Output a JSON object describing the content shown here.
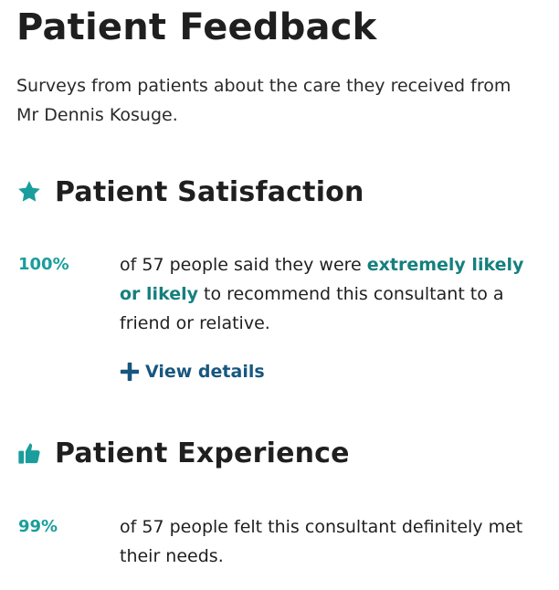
{
  "page": {
    "title": "Patient Feedback",
    "intro": "Surveys from patients about the care they received from Mr Dennis Kosuge."
  },
  "colors": {
    "accent_teal": "#1a9e9c",
    "highlight_teal": "#15807e",
    "link_blue": "#17577e",
    "text_dark": "#1f1f1f"
  },
  "satisfaction": {
    "icon": "star-icon",
    "heading": "Patient Satisfaction",
    "percent": "100%",
    "text_before": "of 57 people said they were ",
    "highlight": "extremely likely or likely",
    "text_after": " to recommend this consultant to a friend or relative.",
    "view_details_icon": "plus-icon",
    "view_details_label": "View details"
  },
  "experience": {
    "icon": "thumbs-up-icon",
    "heading": "Patient Experience",
    "percent": "99%",
    "text": "of 57 people felt this consultant definitely met their needs."
  }
}
